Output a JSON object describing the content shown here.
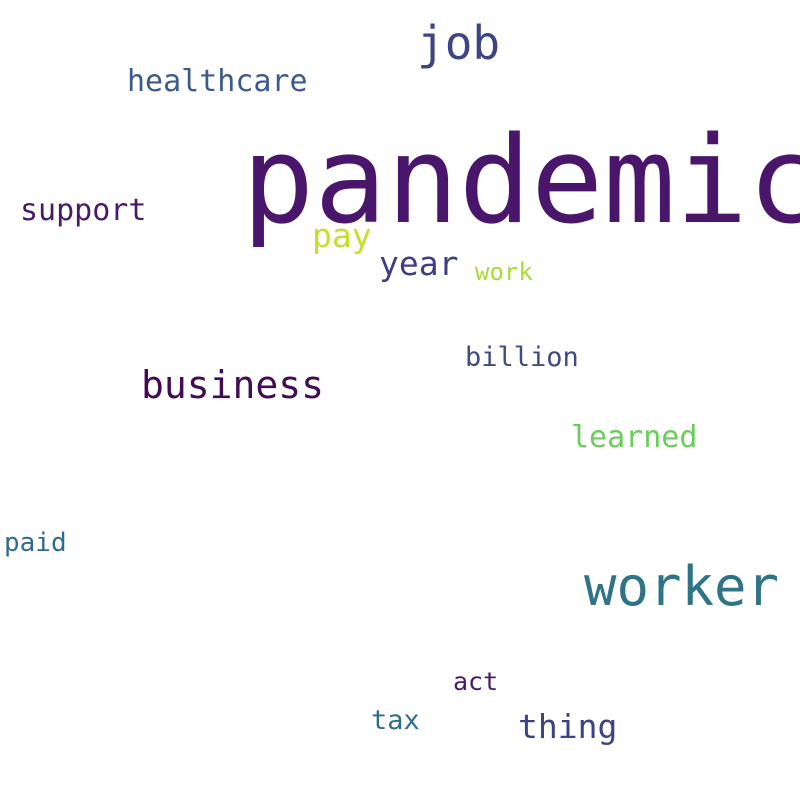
{
  "words": [
    {
      "text": "pandemic",
      "color": "#4a166b"
    },
    {
      "text": "worker",
      "color": "#2f7387"
    },
    {
      "text": "job",
      "color": "#3e4583"
    },
    {
      "text": "business",
      "color": "#430a55"
    },
    {
      "text": "healthcare",
      "color": "#3b5b8c"
    },
    {
      "text": "support",
      "color": "#481a67"
    },
    {
      "text": "year",
      "color": "#3d3f82"
    },
    {
      "text": "pay",
      "color": "#c4df2c"
    },
    {
      "text": "work",
      "color": "#a9db35"
    },
    {
      "text": "billion",
      "color": "#3f4b84"
    },
    {
      "text": "learned",
      "color": "#6acd5a"
    },
    {
      "text": "paid",
      "color": "#2f6b8c"
    },
    {
      "text": "thing",
      "color": "#3d4280"
    },
    {
      "text": "act",
      "color": "#471b61"
    },
    {
      "text": "tax",
      "color": "#2d6e88"
    }
  ]
}
